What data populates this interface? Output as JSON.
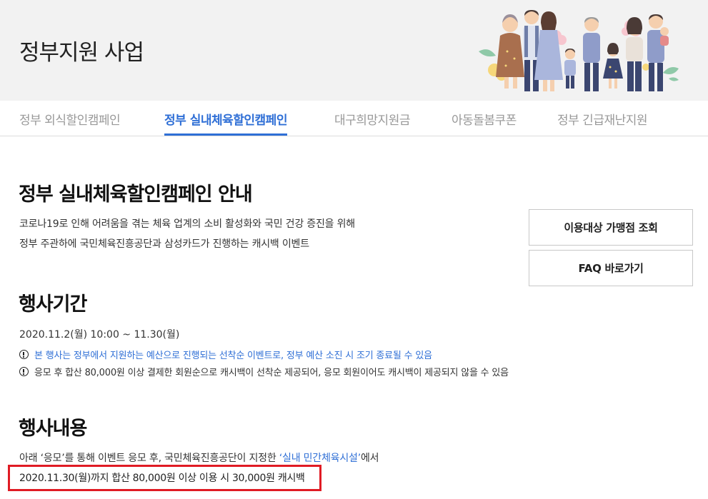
{
  "header": {
    "title": "정부지원 사업"
  },
  "tabs": [
    {
      "label": "정부 외식할인캠페인",
      "active": false
    },
    {
      "label": "정부 실내체육할인캠페인",
      "active": true
    },
    {
      "label": "대구희망지원금",
      "active": false
    },
    {
      "label": "아동돌봄쿠폰",
      "active": false
    },
    {
      "label": "정부 긴급재난지원",
      "active": false
    }
  ],
  "intro": {
    "title": "정부 실내체육할인캠페인 안내",
    "line1": "코로나19로 인해 어려움을 겪는 체육 업계의 소비 활성화와 국민 건강 증진을 위해",
    "line2": "정부 주관하에 국민체육진흥공단과 삼성카드가 진행하는 캐시백 이벤트",
    "btn_merchant": "이용대상 가맹점 조회",
    "btn_faq": "FAQ 바로가기"
  },
  "period": {
    "title": "행사기간",
    "dates": "2020.11.2(월) 10:00 ~ 11.30(월)",
    "notice1": "본 행사는 정부에서 지원하는 예산으로 진행되는 선착순 이벤트로, 정부 예산 소진 시 조기 종료될 수 있음",
    "notice2": "응모 후 합산 80,000원 이상 결제한 회원순으로 캐시백이 선착순 제공되어, 응모 회원이어도 캐시백이 제공되지 않을 수 있음"
  },
  "content": {
    "title": "행사내용",
    "line_before": "아래 ‘응모’를 통해 이벤트 응모 후, 국민체육진흥공단이 지정한 ",
    "line_link": "‘실내 민간체육시설’",
    "line_after": "에서",
    "highlight": "2020.11.30(월)까지 합산 80,000원 이상 이용 시 30,000원 캐시백"
  },
  "colors": {
    "accent": "#2f6fd6",
    "highlight_border": "#e01b24",
    "header_bg": "#f2f2f2"
  },
  "icons": {
    "notice": "exclamation-circle-icon",
    "illustration": "family-illustration"
  }
}
